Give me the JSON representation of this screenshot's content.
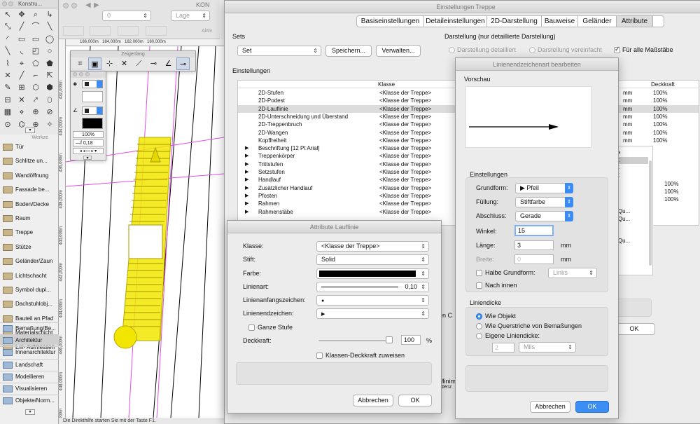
{
  "toolbar_left": {
    "title": "Konstru...",
    "werkze_title": "Werkze"
  },
  "top_app_bar": {
    "layer_value": "0",
    "class_value": "Lage",
    "app_title_fragment": "KON",
    "aktiv_label": "Aktiv"
  },
  "ruler": {
    "marks": [
      "186,000m",
      "184,000m",
      "182,000m",
      "180,000m"
    ],
    "vmarks": [
      "432,000m",
      "434,000m",
      "436,000m",
      "438,000m",
      "440,000m",
      "442,000m",
      "444,000m",
      "446,000m",
      "448,000m",
      "450,000m"
    ]
  },
  "zeigerfang": {
    "title": "Zeigerfang"
  },
  "attr_palette": {
    "zoom": "100%",
    "line_value": "0,18"
  },
  "werkzeuge": {
    "items": [
      "Tür",
      "Schlitze un...",
      "Wandöffnung",
      "Fassade be...",
      "Boden/Decke",
      "Raum",
      "Treppe",
      "Stütze",
      "Geländer/Zaun",
      "Lichtschacht",
      "Symbol dupl...",
      "Dachstuhlobj...",
      "Bauteil an Pfad",
      "Materialschicht",
      "Ein- Aufmessen"
    ],
    "sets": [
      "Bemaßung/Be...",
      "Architektur",
      "Innenarchitektur",
      "Landschaft",
      "Modellieren",
      "Visualisieren",
      "Objekte/Norm..."
    ]
  },
  "status_bar": "Die Direkthilfe starten Sie mit der Taste F1.",
  "main_dialog": {
    "title": "Einstellungen Treppe",
    "tabs": [
      "Basiseinstellungen",
      "Detaileinstellungen",
      "2D-Darstellung",
      "Bauweise",
      "Geländer",
      "Attribute"
    ],
    "sets_label": "Sets",
    "set_value": "Set",
    "save_btn": "Speichern...",
    "manage_btn": "Verwalten...",
    "darstellung_label": "Darstellung (nur detaillierte Darstellung)",
    "radio_detail": "Darstellung detailliert",
    "radio_simple": "Darstellung vereinfacht",
    "all_scales": "Für alle Maßstäbe",
    "einstellungen_label": "Einstellungen",
    "col_klasse": "Klasse",
    "col_deckkraft": "Deckkraft",
    "rows": [
      {
        "name": "2D-Stufen",
        "klasse": "<Klasse der Treppe>",
        "arrow": false,
        "unit": "mm",
        "deck": "100%"
      },
      {
        "name": "2D-Podest",
        "klasse": "<Klasse der Treppe>",
        "arrow": false,
        "unit": "mm",
        "deck": "100%"
      },
      {
        "name": "2D-Lauflinie",
        "klasse": "<Klasse der Treppe>",
        "arrow": false,
        "unit": "mm",
        "deck": "100%"
      },
      {
        "name": "2D-Unterschneidung und Überstand",
        "klasse": "<Klasse der Treppe>",
        "arrow": false,
        "unit": "mm",
        "deck": "100%"
      },
      {
        "name": "2D-Treppenbruch",
        "klasse": "<Klasse der Treppe>",
        "arrow": false,
        "unit": "mm",
        "deck": "100%"
      },
      {
        "name": "2D-Wangen",
        "klasse": "<Klasse der Treppe>",
        "arrow": false,
        "unit": "mm",
        "deck": "100%"
      },
      {
        "name": "Kopffreiheit",
        "klasse": "<Klasse der Treppe>",
        "arrow": false,
        "unit": "mm",
        "deck": "100%"
      },
      {
        "name": "Beschriftung [12 Pt Arial]",
        "klasse": "<Klasse der Treppe>",
        "arrow": true,
        "unit": "",
        "deck": ""
      },
      {
        "name": "Treppenkörper",
        "klasse": "<Klasse der Treppe>",
        "arrow": true,
        "unit": "",
        "deck": ""
      },
      {
        "name": "Trittstufen",
        "klasse": "<Klasse der Treppe>",
        "arrow": true,
        "unit": "",
        "deck": ""
      },
      {
        "name": "Setzstufen",
        "klasse": "<Klasse der Treppe>",
        "arrow": true,
        "unit": "",
        "deck": ""
      },
      {
        "name": "Handlauf",
        "klasse": "<Klasse der Treppe>",
        "arrow": true,
        "unit": "",
        "deck": ""
      },
      {
        "name": "Zusätzlicher Handlauf",
        "klasse": "<Klasse der Treppe>",
        "arrow": true,
        "unit": "",
        "deck": ""
      },
      {
        "name": "Pfosten",
        "klasse": "<Klasse der Treppe>",
        "arrow": true,
        "unit": "",
        "deck": ""
      },
      {
        "name": "Rahmen",
        "klasse": "<Klasse der Treppe>",
        "arrow": true,
        "unit": "",
        "deck": ""
      },
      {
        "name": "Rahmenstäbe",
        "klasse": "<Klasse der Treppe>",
        "arrow": true,
        "unit": "",
        "deck": ""
      }
    ],
    "right_list": [
      "cke",
      "ekt",
      "ekt",
      "ekt",
      "n",
      "n",
      "n",
      "n",
      "n. Qu...",
      "n. Qu...",
      "n",
      "n",
      "n. Qu...",
      "n",
      "n",
      "n",
      "n"
    ],
    "right_pcts": [
      "100%",
      "100%",
      "100%"
    ],
    "ok": "OK",
    "frag_ca": "en C",
    "frag_minim": "Minim",
    "frag_istenz": "istenz"
  },
  "attr_dialog": {
    "title": "Attribute Lauflinie",
    "klasse_label": "Klasse:",
    "klasse_value": "<Klasse der Treppe>",
    "stift_label": "Stift:",
    "stift_value": "Solid",
    "farbe_label": "Farbe:",
    "linienart_label": "Linienart:",
    "linienart_value": "0,10",
    "anfang_label": "Linienanfangszeichen:",
    "anfang_value": "●",
    "ende_label": "Linienendzeichen:",
    "ende_value": "▶",
    "ganze_stufe": "Ganze Stufe",
    "deckkraft_label": "Deckkraft:",
    "deckkraft_value": "100",
    "deckkraft_unit": "%",
    "deckkraft_fraction": 1.0,
    "klassen_deckkraft": "Klassen-Deckkraft zuweisen",
    "cancel": "Abbrechen",
    "ok": "OK"
  },
  "endmark_dialog": {
    "title": "Linienendzeichenart bearbeiten",
    "vorschau": "Vorschau",
    "einstellungen": "Einstellungen",
    "grundform_label": "Grundform:",
    "grundform_value": "▶ Pfeil",
    "fuellung_label": "Füllung:",
    "fuellung_value": "Stiftfarbe",
    "abschluss_label": "Abschluss:",
    "abschluss_value": "Gerade",
    "winkel_label": "Winkel:",
    "winkel_value": "15",
    "laenge_label": "Länge:",
    "laenge_value": "3",
    "laenge_unit": "mm",
    "breite_label": "Breite:",
    "breite_value": "0",
    "breite_unit": "mm",
    "halbe": "Halbe Grundform:",
    "halbe_value": "Links",
    "nach_innen": "Nach innen",
    "liniendicke": "Liniendicke",
    "wie_objekt": "Wie Objekt",
    "wie_quer": "Wie Querstriche von Bemaßungen",
    "eigene": "Eigene Liniendicke:",
    "eigene_value": "2",
    "eigene_unit": "Mils",
    "cancel": "Abbrechen",
    "ok": "OK"
  }
}
